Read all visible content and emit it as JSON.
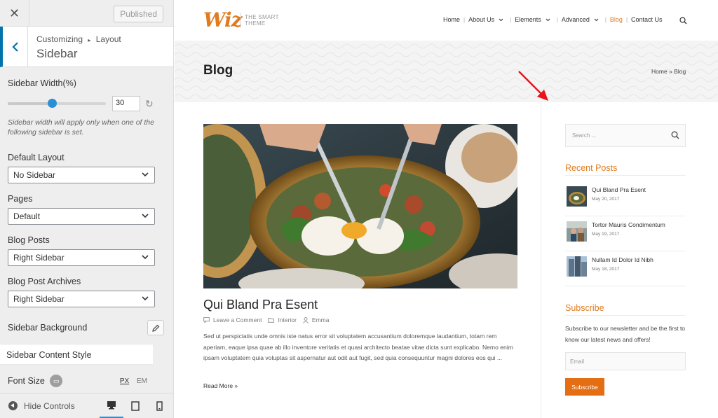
{
  "customizer": {
    "published_label": "Published",
    "breadcrumb": {
      "parent": "Customizing",
      "separator": "▸",
      "section": "Layout",
      "title": "Sidebar"
    },
    "sidebar_width": {
      "label": "Sidebar Width(%)",
      "value": "30",
      "slider_fraction": 0.45
    },
    "description": "Sidebar width will apply only when one of the following sidebar is set.",
    "default_layout": {
      "label": "Default Layout",
      "selected": "No Sidebar"
    },
    "pages": {
      "label": "Pages",
      "selected": "Default"
    },
    "blog_posts": {
      "label": "Blog Posts",
      "selected": "Right Sidebar"
    },
    "blog_post_archives": {
      "label": "Blog Post Archives",
      "selected": "Right Sidebar"
    },
    "sidebar_background_label": "Sidebar Background",
    "sidebar_content_style_label": "Sidebar Content Style",
    "font_size": {
      "label": "Font Size",
      "unit_px": "PX",
      "unit_em": "EM"
    },
    "footer": {
      "hide_controls_label": "Hide Controls"
    },
    "accent_color": "#2b8fd5"
  },
  "site": {
    "logo": {
      "word": "Wiz",
      "tagline_line1": "THE SMART",
      "tagline_line2": "THEME"
    },
    "nav": {
      "home": "Home",
      "about": "About Us",
      "elements": "Elements",
      "advanced": "Advanced",
      "blog": "Blog",
      "contact": "Contact Us"
    },
    "page_title": "Blog",
    "breadcrumb": {
      "home": "Home",
      "sep": "»",
      "current": "Blog"
    },
    "post": {
      "title": "Qui Bland Pra Esent",
      "meta_comment": "Leave a Comment",
      "meta_category": "Interior",
      "meta_author": "Emma",
      "excerpt": "Sed ut perspiciatis unde omnis iste natus error sit voluptatem accusantium doloremque laudantium, totam rem aperiam, eaque ipsa quae ab illo inventore veritatis et quasi architecto beatae vitae dicta sunt explicabo. Nemo enim ipsam voluptatem quia voluptas sit aspernatur aut odit aut fugit, sed quia consequuntur magni dolores eos qui ...",
      "read_more": "Read More »"
    },
    "sidebar": {
      "search_placeholder": "Search ...",
      "recent_posts_title": "Recent Posts",
      "recent_posts": [
        {
          "title": "Qui Bland Pra Esent",
          "date": "May 20, 2017"
        },
        {
          "title": "Tortor Mauris Condimentum",
          "date": "May 19, 2017"
        },
        {
          "title": "Nullam Id Dolor Id Nibh",
          "date": "May 18, 2017"
        }
      ],
      "subscribe_title": "Subscribe",
      "subscribe_text": "Subscribe to our newsletter and be the first to know our latest news and offers!",
      "email_placeholder": "Email",
      "subscribe_button": "Subscribe"
    },
    "brand_color": "#e07b1f"
  }
}
